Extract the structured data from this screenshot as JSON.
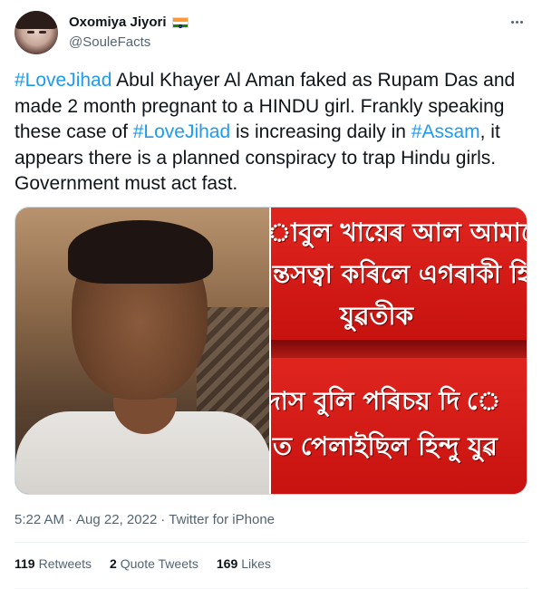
{
  "author": {
    "display_name": "Oxomiya Jiyori",
    "handle": "@SouleFacts",
    "flag_icon": "india-flag-icon"
  },
  "tweet": {
    "segments": [
      {
        "text": "#LoveJihad",
        "hashtag": true
      },
      {
        "text": " Abul Khayer Al Aman faked as Rupam Das and made 2 month pregnant to a HINDU girl. Frankly speaking these case of ",
        "hashtag": false
      },
      {
        "text": "#LoveJihad",
        "hashtag": true
      },
      {
        "text": " is increasing daily in ",
        "hashtag": false
      },
      {
        "text": "#Assam",
        "hashtag": true
      },
      {
        "text": ", it appears there is a planned conspiracy to trap Hindu girls. Government must act fast.",
        "hashtag": false
      }
    ]
  },
  "media": {
    "right_image_text": {
      "top_panel": [
        "াবুল খায়েৰ আল আমানে",
        "ন্তসত্বা কৰিলে এগৰাকী হি",
        "যুৱতীক"
      ],
      "bottom_panel": [
        "দাস বুলি পৰিচয় দি ে",
        "ত পেলাইছিল হিন্দু যুৱ"
      ]
    }
  },
  "meta": {
    "time": "5:22 AM",
    "separator": "·",
    "date": "Aug 22, 2022",
    "source": "Twitter for iPhone"
  },
  "stats": [
    {
      "count": "119",
      "label": "Retweets"
    },
    {
      "count": "2",
      "label": "Quote Tweets"
    },
    {
      "count": "169",
      "label": "Likes"
    }
  ],
  "colors": {
    "hashtag": "#1d9bf0",
    "secondary_text": "#536471",
    "banner_red": "#d91e1a"
  }
}
